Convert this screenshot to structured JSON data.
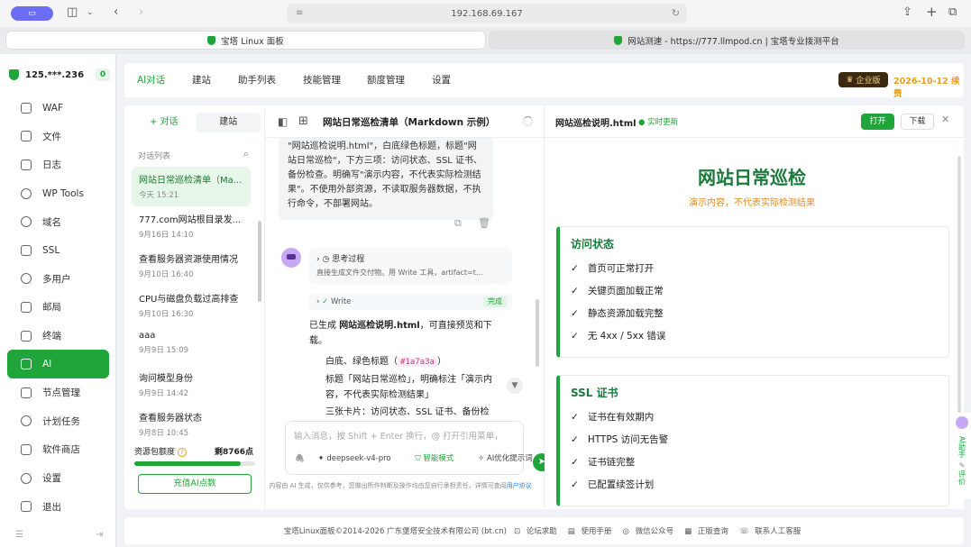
{
  "browser": {
    "url": "192.168.69.167",
    "tabs": [
      {
        "label": "宝塔 Linux 面板"
      },
      {
        "label": "网站测速 - https://777.llmpod.cn | 宝塔专业拨测平台"
      }
    ]
  },
  "sidebar": {
    "server": "125.***.236",
    "badge": "0",
    "items": [
      {
        "label": "WAF"
      },
      {
        "label": "文件"
      },
      {
        "label": "日志"
      },
      {
        "label": "WP Tools"
      },
      {
        "label": "域名"
      },
      {
        "label": "SSL"
      },
      {
        "label": "多用户"
      },
      {
        "label": "邮局"
      },
      {
        "label": "终端"
      },
      {
        "label": "AI"
      },
      {
        "label": "节点管理"
      },
      {
        "label": "计划任务"
      },
      {
        "label": "软件商店"
      },
      {
        "label": "设置"
      },
      {
        "label": "退出"
      }
    ]
  },
  "topnav": {
    "items": [
      "AI对话",
      "建站",
      "助手列表",
      "技能管理",
      "额度管理",
      "设置"
    ],
    "edition": "企业版",
    "renew_date": "2026-10-12",
    "renew_label": "续费"
  },
  "convlist": {
    "tab_chat": "+ 对话",
    "tab_build": "建站",
    "header": "对话列表",
    "items": [
      {
        "title": "网站日常巡检清单（Ma...",
        "date": "今天 15:21"
      },
      {
        "title": "777.com网站根目录发...",
        "date": "9月16日 14:10"
      },
      {
        "title": "查看服务器资源使用情况",
        "date": "9月10日 16:40"
      },
      {
        "title": "CPU与磁盘负载过高排查",
        "date": "9月10日 16:30"
      },
      {
        "title": "aaa",
        "date": "9月9日 15:09"
      },
      {
        "title": "询问模型身份",
        "date": "9月9日 14:42"
      },
      {
        "title": "查看服务器状态",
        "date": "9月8日 10:45"
      }
    ],
    "quota_label": "资源包额度",
    "quota_help": "?",
    "quota_remaining": "剩8766点",
    "quota_fraction": 0.88,
    "recharge": "充值AI点数"
  },
  "chat": {
    "title": "网站日常巡检清单（Markdown 示例）",
    "user_message": "\"网站巡检说明.html\"，白底绿色标题，标题\"网站日常巡检\"，下方三项：访问状态、SSL 证书、备份检查。明确写\"演示内容，不代表实际检测结果\"。不使用外部资源，不读取服务器数据，不执行命令，不部署网站。",
    "think_title": "思考过程",
    "think_summary": "直接生成文件交付物。用 Write 工具，artifact=t...",
    "write_label": "Write",
    "write_status": "完成",
    "reply_prefix": "已生成 ",
    "reply_file": "网站巡检说明.html",
    "reply_suffix": "，可直接预览和下载。",
    "bullet1_prefix": "白底、绿色标题（",
    "bullet1_code": "#1a7a3a",
    "bullet1_suffix": "）",
    "bullet2": "标题「网站日常巡检」，明确标注「演示内容，不代表实际检测结果」",
    "bullet3": "三张卡片：访问状态、SSL 证书、备份检",
    "input_placeholder": "输入消息，按 Shift + Enter 换行，@ 打开引用菜单，",
    "model": "deepseek-v4-pro",
    "smart_mode": "智能模式",
    "ai_optimize": "AI优化提示词",
    "disclaimer": "内容由 AI 生成，仅供参考，您做出所作判断及操作均由您自行承担责任，详情可查阅",
    "disclaimer_link": "用户协议"
  },
  "preview": {
    "filename": "网站巡检说明.html",
    "live": "实时更新",
    "open": "打开",
    "download": "下载",
    "page_title": "网站日常巡检",
    "page_subtitle": "演示内容，不代表实际检测结果",
    "cards": [
      {
        "title": "访问状态",
        "items": [
          "首页可正常打开",
          "关键页面加载正常",
          "静态资源加载完整",
          "无 4xx / 5xx 错误"
        ]
      },
      {
        "title": "SSL 证书",
        "items": [
          "证书在有效期内",
          "HTTPS 访问无告警",
          "证书链完整",
          "已配置续签计划"
        ]
      }
    ]
  },
  "float_widget": {
    "assistant": "AI助手",
    "review": "评价"
  },
  "footer": {
    "copyright": "宝塔Linux面板©2014-2026 广东堡塔安全技术有限公司 (bt.cn)",
    "links": [
      "论坛求助",
      "使用手册",
      "微信公众号",
      "正版查询",
      "联系人工客服"
    ]
  }
}
